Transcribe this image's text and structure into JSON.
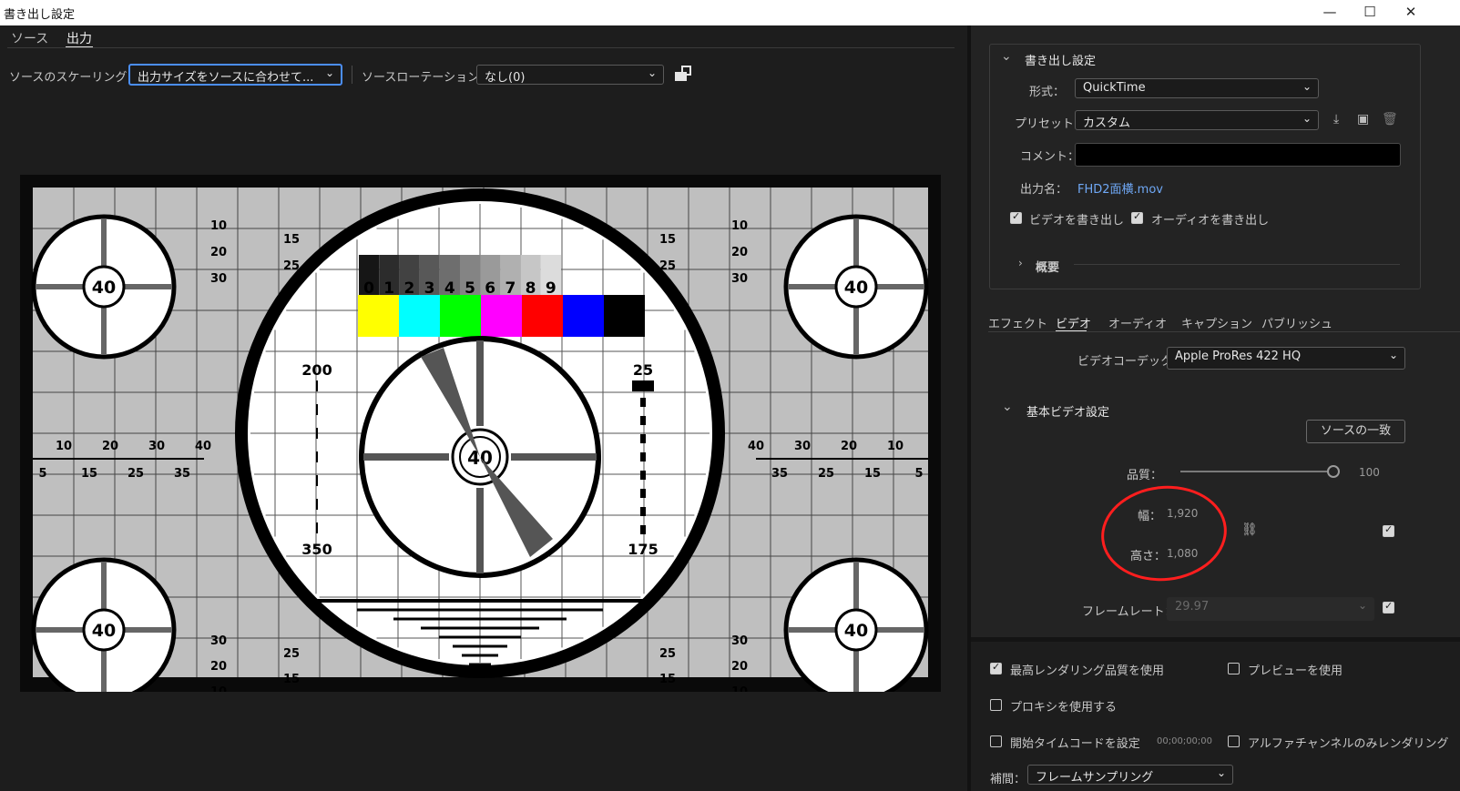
{
  "window": {
    "title": "書き出し設定",
    "minimize": "—",
    "maximize": "☐",
    "close": "✕"
  },
  "tabs": {
    "source": "ソース",
    "output": "出力"
  },
  "toolbar": {
    "scaling_label": "ソースのスケーリング：",
    "scaling_value": "出力サイズをソースに合わせて...",
    "rotation_label": "ソースローテーション：",
    "rotation_value": "なし(0)"
  },
  "export_settings": {
    "header": "書き出し設定",
    "format_label": "形式：",
    "format_value": "QuickTime",
    "preset_label": "プリセット：",
    "preset_value": "カスタム",
    "comment_label": "コメント：",
    "comment_value": "",
    "output_name_label": "出力名：",
    "output_name_value": "FHD2面横.mov",
    "export_video_label": "ビデオを書き出し",
    "export_video_checked": true,
    "export_audio_label": "オーディオを書き出し",
    "export_audio_checked": true,
    "summary_label": "概要"
  },
  "settings_tabs": [
    "エフェクト",
    "ビデオ",
    "オーディオ",
    "キャプション",
    "パブリッシュ"
  ],
  "video": {
    "codec_label": "ビデオコーデック：",
    "codec_value": "Apple ProRes 422 HQ",
    "basic_header": "基本ビデオ設定",
    "match_source_button": "ソースの一致",
    "quality_label": "品質：",
    "quality_value": "100",
    "quality_level": 1.0,
    "width_label": "幅：",
    "width_value": "1,920",
    "height_label": "高さ：",
    "height_value": "1,080",
    "framerate_label": "フレームレート：",
    "framerate_value": "29.97"
  },
  "bottom_options": {
    "max_render_label": "最高レンダリング品質を使用",
    "max_render_checked": true,
    "use_preview_label": "プレビューを使用",
    "use_preview_checked": false,
    "use_proxy_label": "プロキシを使用する",
    "use_proxy_checked": false,
    "start_timecode_label": "開始タイムコードを設定",
    "start_timecode_value": "00;00;00;00",
    "start_timecode_checked": false,
    "alpha_only_label": "アルファチャンネルのみレンダリング",
    "alpha_only_checked": false,
    "interp_label": "補間：",
    "interp_value": "フレームサンプリング"
  },
  "preview": {
    "gray_bars": [
      "0",
      "1",
      "2",
      "3",
      "4",
      "5",
      "6",
      "7",
      "8",
      "9"
    ],
    "color_bars": [
      "#ffff00",
      "#00ffff",
      "#00ff00",
      "#ff00ff",
      "#ff0000",
      "#0000ff",
      "#000000"
    ],
    "center_value": "40",
    "left_scale_top": [
      "10",
      "20",
      "30"
    ],
    "left_scale_top2": [
      "15",
      "25"
    ],
    "mid_scale_top": [
      "10",
      "20",
      "30",
      "40"
    ],
    "mid_scale_bottom": [
      "5",
      "15",
      "25",
      "35"
    ],
    "right_mid_top": [
      "40",
      "30",
      "20",
      "10"
    ],
    "right_mid_bottom": [
      "35",
      "25",
      "15",
      "5"
    ],
    "label_200": "200",
    "label_350": "350",
    "label_25": "25",
    "label_175": "175",
    "corner_value": "40"
  },
  "colors": {
    "accent": "#4b8ef7",
    "link": "#6fa8f5",
    "annotation": "#ff1e1e"
  }
}
